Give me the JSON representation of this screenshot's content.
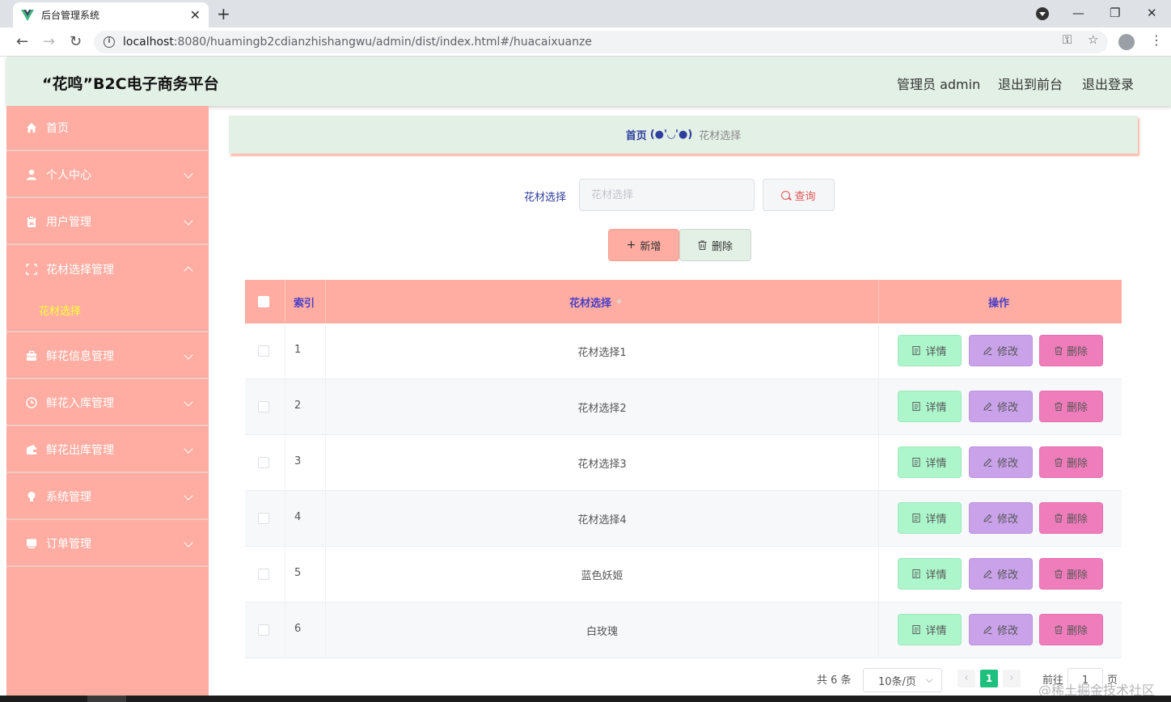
{
  "browser": {
    "tab_title": "后台管理系统",
    "tab_close": "✕",
    "new_tab": "+",
    "url_host": "localhost",
    "url_rest": ":8080/huamingb2cdianzhishangwu/admin/dist/index.html#/huacaixuanze",
    "icons": [
      "back-arrow-icon",
      "forward-arrow-icon",
      "reload-icon",
      "info-icon",
      "key-icon",
      "star-icon",
      "profile-icon",
      "menu-icon"
    ]
  },
  "header": {
    "title": "“花鸣”B2C电子商务平台",
    "user": "管理员 admin",
    "to_front": "退出到前台",
    "logout": "退出登录",
    "bg_color": "#e3f0e6"
  },
  "sidebar": {
    "bg_color": "#ffada2",
    "items": [
      {
        "label": "首页",
        "icon": "home-icon"
      },
      {
        "label": "个人中心",
        "icon": "user-icon"
      },
      {
        "label": "用户管理",
        "icon": "clipboard-icon"
      },
      {
        "label": "花材选择管理",
        "icon": "fullscreen-icon",
        "expanded": true
      },
      {
        "label": "鲜花信息管理",
        "icon": "briefcase-icon"
      },
      {
        "label": "鲜花入库管理",
        "icon": "clock-icon"
      },
      {
        "label": "鲜花出库管理",
        "icon": "wallet-icon"
      },
      {
        "label": "系统管理",
        "icon": "lightbulb-icon"
      },
      {
        "label": "订单管理",
        "icon": "monitor-icon"
      }
    ],
    "sub_item": "花材选择"
  },
  "breadcrumb": {
    "home": "首页",
    "face": "(●'◡'●)",
    "current": "花材选择"
  },
  "search": {
    "label": "花材选择",
    "placeholder": "花材选择",
    "button": "查询"
  },
  "toolbar": {
    "add": "新增",
    "delete": "删除"
  },
  "table": {
    "headers": {
      "index": "索引",
      "name": "花材选择",
      "actions": "操作"
    },
    "rows": [
      {
        "index": "1",
        "name": "花材选择1"
      },
      {
        "index": "2",
        "name": "花材选择2"
      },
      {
        "index": "3",
        "name": "花材选择3"
      },
      {
        "index": "4",
        "name": "花材选择4"
      },
      {
        "index": "5",
        "name": "蓝色妖姬"
      },
      {
        "index": "6",
        "name": "白玫瑰"
      }
    ],
    "actions": {
      "detail": "详情",
      "edit": "修改",
      "delete": "删除"
    }
  },
  "pagination": {
    "total": "共 6 条",
    "page_size": "10条/页",
    "current_page": "1",
    "goto_prefix": "前往",
    "goto_value": "1",
    "goto_suffix": "页"
  },
  "watermark": "@稀土掘金技术社区"
}
